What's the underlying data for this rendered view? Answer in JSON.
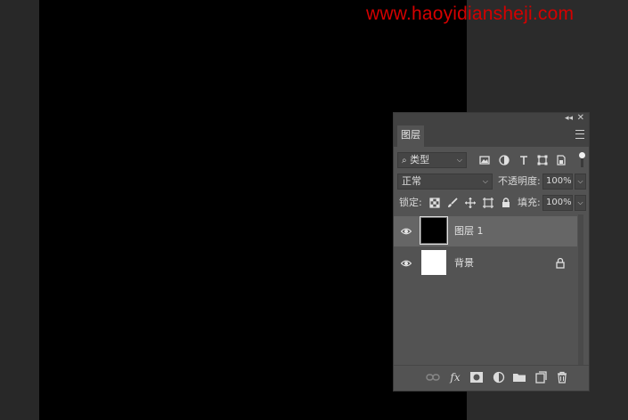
{
  "watermark": "www.haoyidiansheji.com",
  "panel": {
    "title_tab": "图层",
    "filter": {
      "label": "类型"
    },
    "blend_mode": "正常",
    "opacity_label": "不透明度:",
    "opacity_value": "100%",
    "lock_label": "锁定:",
    "fill_label": "填充:",
    "fill_value": "100%",
    "layers": [
      {
        "name": "图层 1",
        "thumb_color": "#000000",
        "selected": true,
        "locked": false
      },
      {
        "name": "背景",
        "thumb_color": "#ffffff",
        "selected": false,
        "locked": true
      }
    ],
    "bottom_icons": [
      "link-icon",
      "fx-icon",
      "mask-icon",
      "adjustment-icon",
      "folder-icon",
      "new-layer-icon",
      "trash-icon"
    ],
    "fx_label": "fx"
  },
  "colors": {
    "canvas": "#000000",
    "panel_bg": "#535353",
    "selected_layer": "#666666",
    "watermark": "#d40000"
  }
}
